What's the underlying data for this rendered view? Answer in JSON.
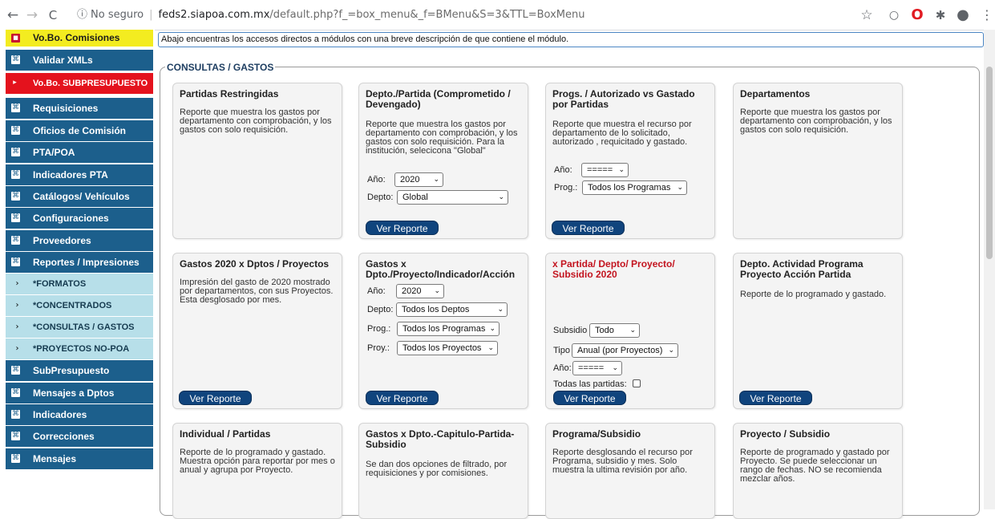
{
  "browser": {
    "back": "←",
    "forward": "→",
    "reload": "C",
    "info_icon": "ⓘ",
    "security": "No seguro",
    "separator": "|",
    "url_host": "feds2.siapoa.com.mx",
    "url_path": "/default.php?f_=box_menu&_f=BMenu&S=3&TTL=BoxMenu",
    "star": "☆",
    "ext1": "○",
    "ext2": "O",
    "ext3": "✱",
    "profile": "●",
    "menu": "⋮"
  },
  "sidebar": {
    "items": [
      {
        "label": "Vo.Bo. Comisiones",
        "icon": "■",
        "kind": "yellow"
      },
      {
        "label": "Validar XMLs",
        "icon": "⌘",
        "kind": "normal"
      },
      {
        "label": "Vo.Bo. SUBPRESUPUESTO",
        "icon": "▸",
        "kind": "red"
      },
      {
        "label": "Requisiciones",
        "icon": "⌘",
        "kind": "normal"
      },
      {
        "label": "Oficios de Comisión",
        "icon": "⌘",
        "kind": "normal"
      },
      {
        "label": "PTA/POA",
        "icon": "⌘",
        "kind": "normal"
      },
      {
        "label": "Indicadores PTA",
        "icon": "⌘",
        "kind": "normal"
      },
      {
        "label": "Catálogos/ Vehículos",
        "icon": "⌘",
        "kind": "normal"
      },
      {
        "label": "Configuraciones",
        "icon": "⌘",
        "kind": "normal"
      },
      {
        "label": "Proveedores",
        "icon": "⌘",
        "kind": "normal"
      },
      {
        "label": "Reportes / Impresiones",
        "icon": "⌘",
        "kind": "normal"
      },
      {
        "label": "*FORMATOS",
        "icon": "›",
        "kind": "sub"
      },
      {
        "label": "*CONCENTRADOS",
        "icon": "›",
        "kind": "sub"
      },
      {
        "label": "*CONSULTAS / GASTOS",
        "icon": "›",
        "kind": "sub"
      },
      {
        "label": "*PROYECTOS NO-POA",
        "icon": "›",
        "kind": "sub"
      },
      {
        "label": "SubPresupuesto",
        "icon": "⌘",
        "kind": "normal"
      },
      {
        "label": "Mensajes a Dptos",
        "icon": "⌘",
        "kind": "normal"
      },
      {
        "label": "Indicadores",
        "icon": "⌘",
        "kind": "normal"
      },
      {
        "label": "Correcciones",
        "icon": "⌘",
        "kind": "normal"
      },
      {
        "label": "Mensajes",
        "icon": "⌘",
        "kind": "normal"
      }
    ]
  },
  "main": {
    "notice": "Abajo encuentras los accesos directos a módulos con una breve descripción de que contiene el módulo.",
    "section_title": "CONSULTAS / GASTOS",
    "button_label": "Ver Reporte",
    "cards": {
      "c1": {
        "title": "Partidas Restringidas",
        "desc": "Reporte que muestra los gastos por departamento con comprobación, y los gastos con solo requisición."
      },
      "c2": {
        "title": "Depto./Partida (Comprometido / Devengado)",
        "desc": "Reporte que muestra los gastos por departamento con comprobación, y los gastos con solo requisición. Para la institución, selecicona \"Global\"",
        "anio_label": "Año:",
        "anio_value": "2020",
        "depto_label": "Depto:",
        "depto_value": "Global"
      },
      "c3": {
        "title": "Progs. / Autorizado vs Gastado por Partidas",
        "desc": "Reporte que muestra el recurso por departamento de lo solicitado, autorizado , requicitado y gastado.",
        "anio_label": "Año:",
        "anio_value": "=====",
        "prog_label": "Prog.:",
        "prog_value": "Todos los Programas"
      },
      "c4": {
        "title": "Departamentos",
        "desc": "Reporte que muestra los gastos por departamento con comprobación, y los gastos con solo requisición."
      },
      "c5": {
        "title": "Gastos 2020 x Dptos / Proyectos",
        "desc": "Impresión del gasto de 2020 mostrado por departamentos, con sus Proyectos. Esta desglosado por mes."
      },
      "c6": {
        "title": "Gastos x Dpto./Proyecto/Indicador/Acción",
        "anio_label": "Año:",
        "anio_value": "2020",
        "depto_label": "Depto:",
        "depto_value": "Todos los Deptos",
        "prog_label": "Prog.:",
        "prog_value": "Todos los Programas",
        "proy_label": "Proy.:",
        "proy_value": "Todos los Proyectos"
      },
      "c7": {
        "title": "x Partida/ Depto/ Proyecto/ Subsidio 2020",
        "subsidio_label": "Subsidio",
        "subsidio_value": "Todo",
        "tipo_label": "Tipo",
        "tipo_value": "Anual (por Proyectos)",
        "anio_label": "Año:",
        "anio_value": "=====",
        "todas_label": "Todas las partidas:"
      },
      "c8": {
        "title": "Depto. Actividad Programa Proyecto Acción Partida",
        "desc": "Reporte de lo programado y gastado."
      },
      "c9": {
        "title": "Individual / Partidas",
        "desc": "Reporte de lo programado y gastado. Muestra opción para reportar por mes o anual y agrupa por Proyecto."
      },
      "c10": {
        "title": "Gastos x Dpto.-Capitulo-Partida-Subsidio",
        "desc": "Se dan dos opciones de filtrado, por requisiciones y por comisiones."
      },
      "c11": {
        "title": "Programa/Subsidio",
        "desc": "Reporte desglosando el recurso por Programa, subsidio y mes. Solo muestra la ultima revisión por año."
      },
      "c12": {
        "title": "Proyecto / Subsidio",
        "desc": "Reporte de programado y gastado por Proyecto. Se puede seleccionar un rango de fechas. NO se recomienda mezclar años."
      }
    }
  }
}
